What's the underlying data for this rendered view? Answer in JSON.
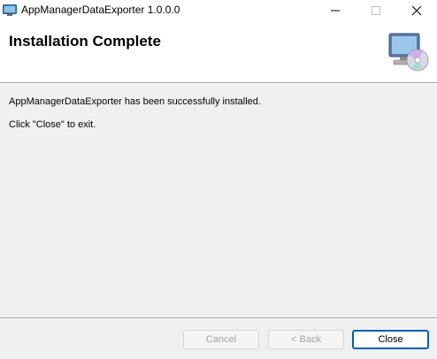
{
  "window": {
    "title": "AppManagerDataExporter 1.0.0.0",
    "app_icon": "installer-monitor-icon",
    "controls": {
      "minimize_icon": "minimize-icon",
      "maximize_icon": "maximize-icon",
      "close_icon": "close-icon"
    }
  },
  "banner": {
    "title": "Installation Complete",
    "icon": "computer-cd-icon"
  },
  "body": {
    "message": "AppManagerDataExporter has been successfully installed.",
    "instruction": "Click \"Close\" to exit."
  },
  "buttons": {
    "cancel_label": "Cancel",
    "back_label": "< Back",
    "close_label": "Close"
  },
  "colors": {
    "accent": "#005fb8",
    "background": "#f0f0f0",
    "disabled_text": "#a2a2a2"
  }
}
